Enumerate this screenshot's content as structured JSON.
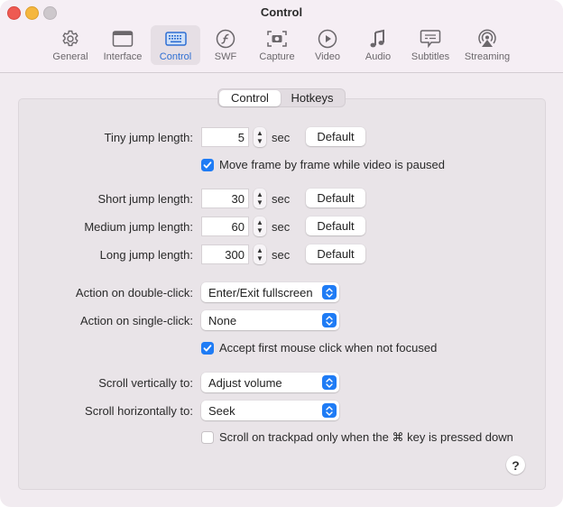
{
  "window": {
    "title": "Control"
  },
  "toolbar": {
    "tabs": [
      {
        "label": "General",
        "icon": "gear-icon"
      },
      {
        "label": "Interface",
        "icon": "window-icon"
      },
      {
        "label": "Control",
        "icon": "keyboard-icon",
        "active": true
      },
      {
        "label": "SWF",
        "icon": "flash-icon"
      },
      {
        "label": "Capture",
        "icon": "camera-icon"
      },
      {
        "label": "Video",
        "icon": "play-icon"
      },
      {
        "label": "Audio",
        "icon": "music-note-icon"
      },
      {
        "label": "Subtitles",
        "icon": "speech-bubble-icon"
      },
      {
        "label": "Streaming",
        "icon": "airplay-icon"
      }
    ]
  },
  "segmented": {
    "items": [
      "Control",
      "Hotkeys"
    ],
    "selected": "Control"
  },
  "jumps": {
    "tiny": {
      "label": "Tiny jump length:",
      "value": "5",
      "unit": "sec",
      "default_label": "Default"
    },
    "short": {
      "label": "Short jump length:",
      "value": "30",
      "unit": "sec",
      "default_label": "Default"
    },
    "medium": {
      "label": "Medium jump length:",
      "value": "60",
      "unit": "sec",
      "default_label": "Default"
    },
    "long": {
      "label": "Long jump length:",
      "value": "300",
      "unit": "sec",
      "default_label": "Default"
    }
  },
  "checks": {
    "frame_by_frame": {
      "label": "Move frame by frame while video is paused",
      "checked": true
    },
    "accept_first_click": {
      "label": "Accept first mouse click when not focused",
      "checked": true
    },
    "trackpad_cmd": {
      "label": "Scroll on trackpad only when the ⌘ key is pressed down",
      "checked": false
    }
  },
  "actions": {
    "double_click": {
      "label": "Action on double-click:",
      "value": "Enter/Exit fullscreen"
    },
    "single_click": {
      "label": "Action on single-click:",
      "value": "None"
    },
    "scroll_vertical": {
      "label": "Scroll vertically to:",
      "value": "Adjust volume"
    },
    "scroll_horizontal": {
      "label": "Scroll horizontally to:",
      "value": "Seek"
    }
  },
  "help": {
    "label": "?"
  },
  "colors": {
    "accent": "#1f7cf5",
    "active_tab_text": "#2f6fd3"
  }
}
